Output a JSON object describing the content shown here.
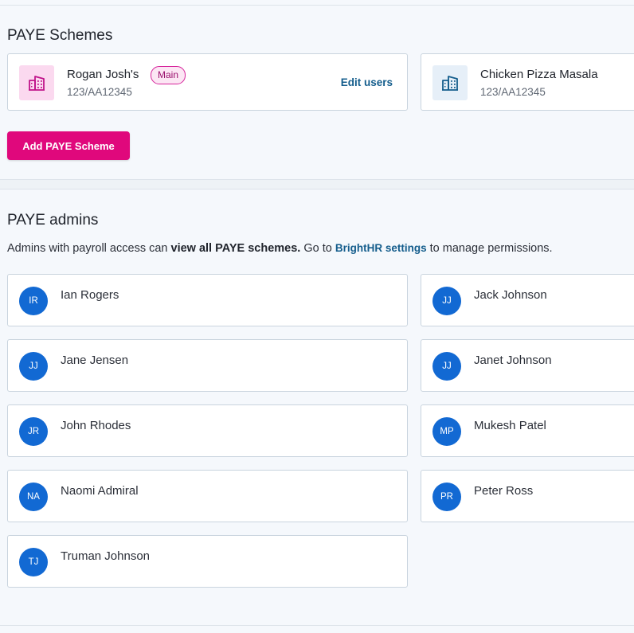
{
  "paye_schemes": {
    "title": "PAYE Schemes",
    "schemes": [
      {
        "name": "Rogan Josh's",
        "badge": "Main",
        "code": "123/AA12345",
        "action": "Edit users",
        "icon": "building-icon",
        "icon_color": "#c0138a"
      },
      {
        "name": "Chicken Pizza Masala",
        "code": "123/AA12345",
        "icon": "building-icon",
        "icon_color": "#145d8c"
      }
    ],
    "add_button": "Add PAYE Scheme"
  },
  "paye_admins": {
    "title": "PAYE admins",
    "description": {
      "part1": "Admins with payroll access can ",
      "bold": "view all PAYE schemes.",
      "part2": " Go to ",
      "link": "BrightHR settings",
      "part3": " to manage permissions."
    },
    "admins": [
      {
        "initials": "IR",
        "name": "Ian Rogers"
      },
      {
        "initials": "JJ",
        "name": "Jack Johnson"
      },
      {
        "initials": "JJ",
        "name": "Jane Jensen"
      },
      {
        "initials": "JJ",
        "name": "Janet Johnson"
      },
      {
        "initials": "JR",
        "name": "John Rhodes"
      },
      {
        "initials": "MP",
        "name": "Mukesh Patel"
      },
      {
        "initials": "NA",
        "name": "Naomi Admiral"
      },
      {
        "initials": "PR",
        "name": "Peter Ross"
      },
      {
        "initials": "TJ",
        "name": "Truman Johnson"
      }
    ]
  },
  "colors": {
    "accent": "#e0087c",
    "link": "#145d8c",
    "avatar": "#1269d3"
  }
}
